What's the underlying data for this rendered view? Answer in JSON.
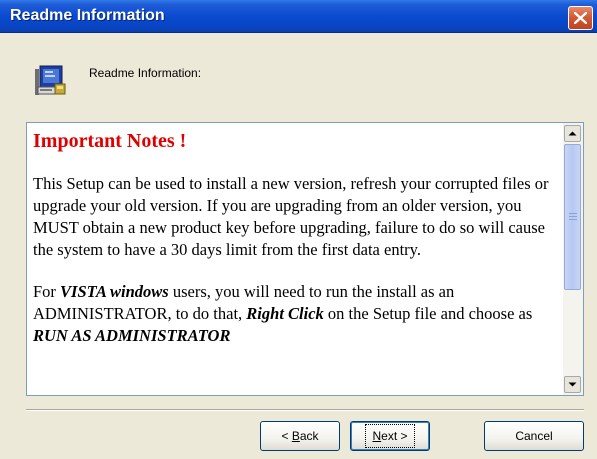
{
  "window": {
    "title": "Readme Information"
  },
  "header": {
    "label": "Readme Information:",
    "icon": "computer-setup-icon"
  },
  "readme": {
    "title": "Important Notes !",
    "para1": "This Setup can be used to install a new version, refresh your corrupted files or upgrade your old version. If you are upgrading from an  older version, you MUST obtain a new product key before upgrading, failure to do so will cause the system to have a 30 days limit from the first data entry.",
    "para2": {
      "part1": "For ",
      "part2": "VISTA windows",
      "part3": " users, you will need to run the install as an ADMINISTRATOR, to do that, ",
      "part4": "Right Click",
      "part5": " on the Setup file and choose as ",
      "part6": "RUN AS ADMINISTRATOR"
    }
  },
  "buttons": {
    "back_mnemonic": "B",
    "back_rest": "ack",
    "back_prefix": "< ",
    "next_mnemonic": "N",
    "next_rest": "ext >",
    "cancel": "Cancel"
  },
  "colors": {
    "title_red": "#E00000",
    "titlebar_blue": "#0A4BD0",
    "dialog_bg": "#ECE9D8"
  }
}
